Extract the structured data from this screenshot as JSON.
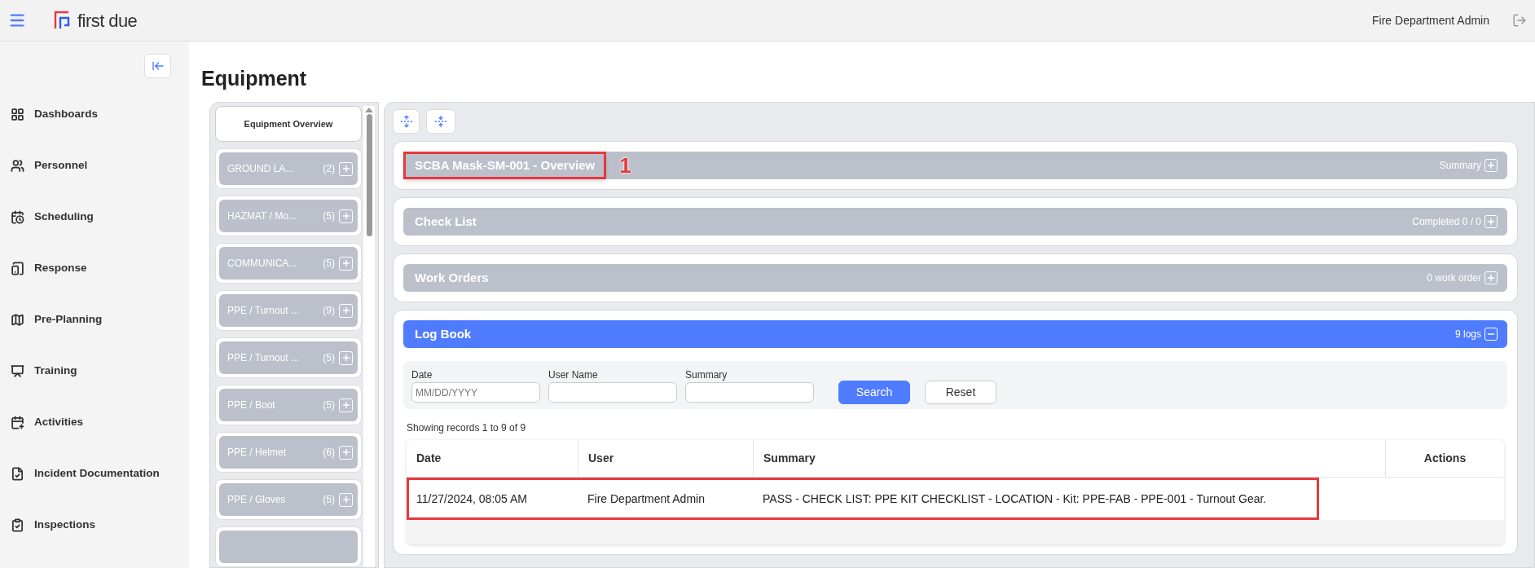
{
  "topbar": {
    "brand": "first due",
    "user": "Fire Department Admin"
  },
  "sidebar": {
    "items": [
      {
        "label": "Dashboards"
      },
      {
        "label": "Personnel"
      },
      {
        "label": "Scheduling"
      },
      {
        "label": "Response"
      },
      {
        "label": "Pre-Planning"
      },
      {
        "label": "Training"
      },
      {
        "label": "Activities"
      },
      {
        "label": "Incident Documentation"
      },
      {
        "label": "Inspections"
      }
    ]
  },
  "page": {
    "title": "Equipment"
  },
  "equipment_list": {
    "overview": "Equipment Overview",
    "categories": [
      {
        "label": "GROUND LA...",
        "count": "(2)"
      },
      {
        "label": "HAZMAT / Mo...",
        "count": "(5)"
      },
      {
        "label": "COMMUNICA...",
        "count": "(5)"
      },
      {
        "label": "PPE / Turnout ...",
        "count": "(9)"
      },
      {
        "label": "PPE / Turnout ...",
        "count": "(5)"
      },
      {
        "label": "PPE / Boot",
        "count": "(5)"
      },
      {
        "label": "PPE / Helmet",
        "count": "(6)"
      },
      {
        "label": "PPE / Gloves",
        "count": "(5)"
      }
    ]
  },
  "sections": [
    {
      "title": "SCBA Mask-SM-001 - Overview",
      "info": "Summary",
      "expanded": false,
      "highlighted": true,
      "marker": "1"
    },
    {
      "title": "Check List",
      "info": "Completed 0 / 0",
      "expanded": false,
      "highlighted": false
    },
    {
      "title": "Work Orders",
      "info": "0 work order",
      "expanded": false,
      "highlighted": false
    },
    {
      "title": "Log Book",
      "info": "9 logs",
      "expanded": true,
      "highlighted": false
    }
  ],
  "logbook": {
    "filters": [
      {
        "label": "Date",
        "placeholder": "MM/DD/YYYY"
      },
      {
        "label": "User Name"
      },
      {
        "label": "Summary"
      }
    ],
    "buttons": [
      {
        "label": "Search",
        "kind": "primary"
      },
      {
        "label": "Reset",
        "kind": "secondary"
      }
    ],
    "records": "Showing records 1 to 9 of 9",
    "columns": [
      "Date",
      "User",
      "Summary",
      "Actions"
    ],
    "rows": [
      {
        "date": "11/27/2024, 08:05 AM",
        "user": "Fire Department Admin",
        "summary": "PASS - CHECK LIST: PPE KIT CHECKLIST - LOCATION - Kit: PPE-FAB - PPE-001 - Turnout Gear.",
        "highlighted": true
      }
    ]
  }
}
